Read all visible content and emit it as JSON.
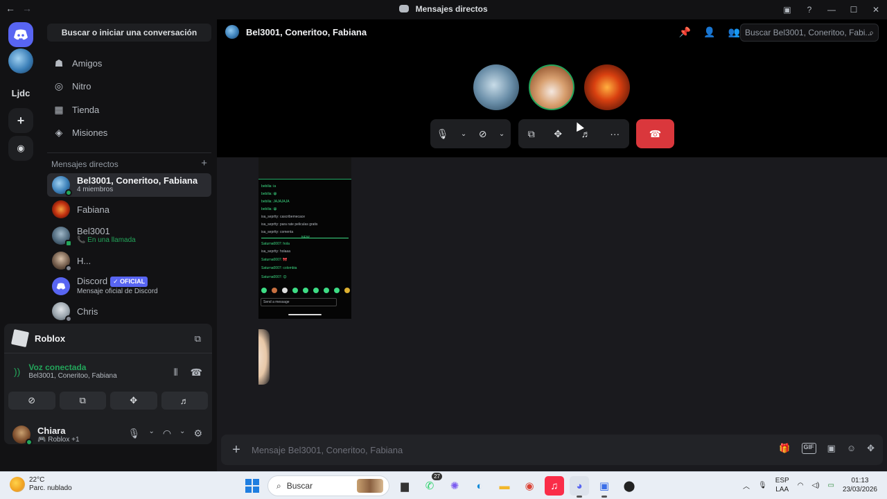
{
  "window": {
    "title": "Mensajes directos",
    "nav_back": "←",
    "nav_forward": "→",
    "controls": {
      "inbox": "▣",
      "help": "?",
      "minimize": "—",
      "maximize": "☐",
      "close": "✕"
    }
  },
  "rail": {
    "home_icon": "discord-logo",
    "servers": [
      {
        "label": "Ljdc"
      }
    ],
    "add_icon": "+",
    "explore_icon": "◉"
  },
  "sidebar": {
    "search_label": "Buscar o iniciar una conversación",
    "nav": [
      {
        "label": "Amigos",
        "icon": "friends-icon",
        "glyph": "☗"
      },
      {
        "label": "Nitro",
        "icon": "nitro-icon",
        "glyph": "◎"
      },
      {
        "label": "Tienda",
        "icon": "shop-icon",
        "glyph": "▦"
      },
      {
        "label": "Misiones",
        "icon": "quests-icon",
        "glyph": "◈"
      }
    ],
    "dm_header": "Mensajes directos",
    "dm_add": "+",
    "dms": [
      {
        "name": "Bel3001, Coneritoo, Fabiana",
        "sub": "4 miembros"
      },
      {
        "name": "Fabiana",
        "sub": ""
      },
      {
        "name": "Bel3001",
        "sub": "📞 En una llamada"
      },
      {
        "name": "H...",
        "sub": ""
      },
      {
        "name": "Discord",
        "badge": "✓ OFICIAL",
        "sub": "Mensaje oficial de Discord"
      },
      {
        "name": "Chris",
        "sub": ""
      }
    ]
  },
  "activity": {
    "game": "Roblox",
    "voice_status": "Voz conectada",
    "voice_channel": "Bel3001, Coneritoo, Fabiana"
  },
  "user": {
    "name": "Chiara",
    "status": "🎮 Roblox +1"
  },
  "main": {
    "channel_title": "Bel3001, Coneritoo, Fabiana",
    "search_placeholder": "Buscar Bel3001, Coneritoo, Fabi...",
    "message_placeholder": "Mensaje Bel3001, Coneritoo, Fabiana",
    "message_plus": "+",
    "phone_lines": [
      "bebilia: ia",
      "bebilia: 😀",
      "bebilia: JAJAJAJA",
      "bebilia: 😀",
      "isa_seprtty: cascribemecace",
      "isa_seprtty: para rate peliculas gratis",
      "isa_seprtty: comenta",
      "Saturna0007: hola",
      "isa_seprtty: holaaa",
      "Saturna0007: 🎀",
      "Saturna0007: colombia",
      "Saturna0007: 😊"
    ],
    "phone_new": "NEW",
    "phone_input": "Send a message"
  },
  "taskbar": {
    "temp": "22°C",
    "weather": "Parc. nublado",
    "search": "Buscar",
    "whatsapp_badge": "27",
    "lang1": "ESP",
    "lang2": "LAA",
    "time": "01:13",
    "date": "23/03/2026"
  },
  "colors": {
    "accent": "#5865f2",
    "online": "#23a55a",
    "end_call": "#da373c"
  }
}
